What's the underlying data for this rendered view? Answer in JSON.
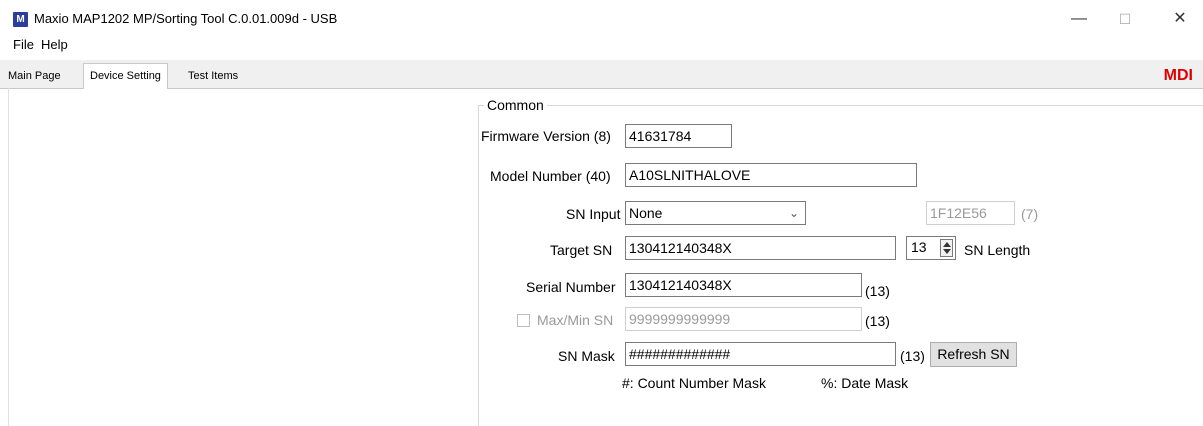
{
  "window": {
    "title": "Maxio MAP1202 MP/Sorting Tool C.0.01.009d - USB",
    "icon_letter": "M",
    "minimize": "—",
    "maximize": "☐",
    "close": "✕"
  },
  "menu": {
    "file": "File",
    "help": "Help"
  },
  "tabs": {
    "main": "Main Page",
    "device": "Device Setting",
    "test": "Test Items"
  },
  "badge": "MDI",
  "common": {
    "title": "Common",
    "firmware_label": "Firmware Version (8)",
    "firmware_value": "41631784",
    "model_label": "Model Number (40)",
    "model_value": "A10SLNITHALOVE",
    "sn_input_label": "SN Input",
    "sn_input_value": "None",
    "hex_value": "1F12E56",
    "hex_count": "(7)",
    "target_label": "Target SN",
    "target_value": "130412140348X",
    "sn_length_value": "13",
    "sn_length_label": "SN Length",
    "serial_label": "Serial Number",
    "serial_value": "130412140348X",
    "serial_count": "(13)",
    "maxmin_label": "Max/Min SN",
    "maxmin_value": "9999999999999",
    "maxmin_count": "(13)",
    "mask_label": "SN Mask",
    "mask_value": "#############",
    "mask_count": "(13)",
    "refresh_button": "Refresh SN",
    "note_count": "#: Count Number Mask",
    "note_date": "%: Date Mask"
  }
}
